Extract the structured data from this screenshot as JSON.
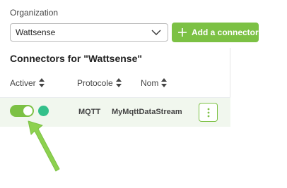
{
  "organization": {
    "label": "Organization",
    "selected": "Wattsense"
  },
  "add_button": {
    "label": "Add a connector",
    "icon": "plus-icon"
  },
  "panel": {
    "title": "Connectors for \"Wattsense\"",
    "columns": [
      {
        "label": "Activer"
      },
      {
        "label": "Protocole"
      },
      {
        "label": "Nom"
      }
    ],
    "rows": [
      {
        "enabled": true,
        "status": "online",
        "protocol": "MQTT",
        "name": "MyMqttDataStream"
      }
    ]
  },
  "colors": {
    "accent": "#7cc144",
    "status_ok": "#33c08a",
    "row_highlight": "#f1f7ee",
    "annotation_arrow": "#8dd14f"
  }
}
